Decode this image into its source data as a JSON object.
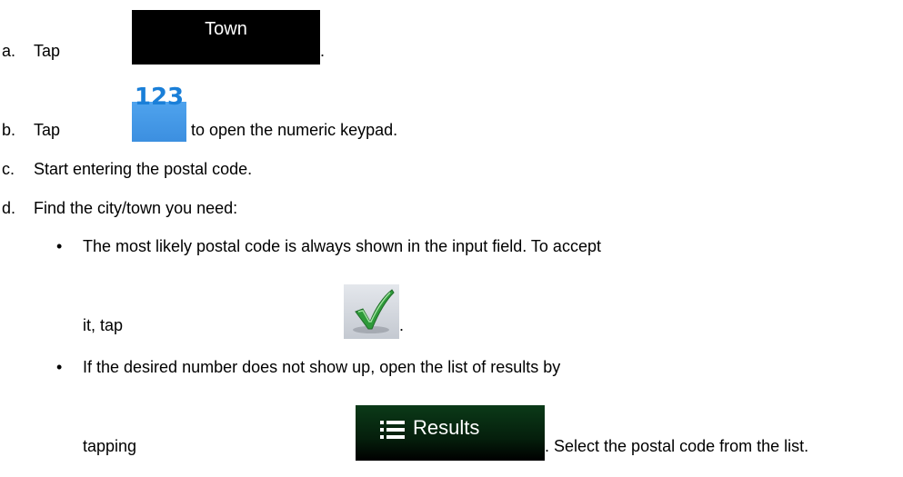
{
  "steps": [
    {
      "letter": "a.",
      "prefix": "Tap",
      "suffix": "."
    },
    {
      "letter": "b.",
      "prefix": "Tap",
      "suffix": "to open the numeric keypad."
    },
    {
      "letter": "c.",
      "text": "Start entering the postal code."
    },
    {
      "letter": "d.",
      "text": "Find the city/town you need:"
    }
  ],
  "buttons": {
    "town_label": "Town",
    "keypad_label": "123",
    "results_label": "Results"
  },
  "bullets": [
    {
      "line1": "The most likely postal code is always shown in the input field. To accept",
      "line2_prefix": "it, tap",
      "line2_suffix": "."
    },
    {
      "line1": "If the desired number does not show up, open the list of results by",
      "line2_prefix": "tapping",
      "line2_suffix": ". Select the postal code from the list."
    }
  ],
  "colors": {
    "keypad_blue": "#1a7fd8",
    "results_bg": "#051f0c",
    "check_green": "#2e9a3a"
  },
  "icons": {
    "checkmark": "checkmark-icon",
    "list": "list-icon"
  }
}
